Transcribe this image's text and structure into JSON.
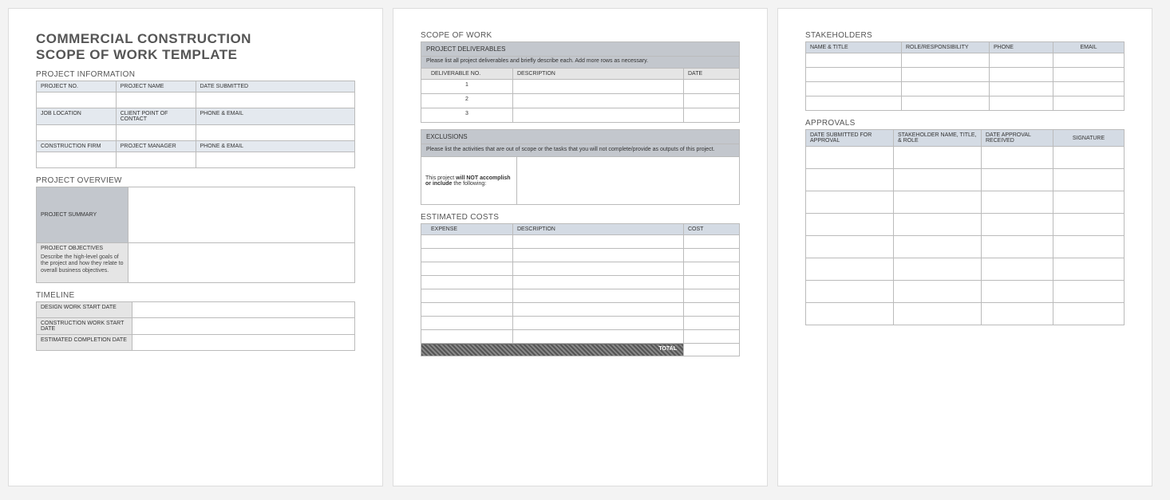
{
  "title_line1": "COMMERCIAL CONSTRUCTION",
  "title_line2": "SCOPE OF WORK TEMPLATE",
  "sections": {
    "project_info": "PROJECT INFORMATION",
    "project_overview": "PROJECT OVERVIEW",
    "timeline": "TIMELINE",
    "scope_of_work": "SCOPE OF WORK",
    "estimated_costs": "ESTIMATED COSTS",
    "stakeholders": "STAKEHOLDERS",
    "approvals": "APPROVALS"
  },
  "project_info": {
    "project_no": "PROJECT NO.",
    "project_name": "PROJECT NAME",
    "date_submitted": "DATE SUBMITTED",
    "job_location": "JOB LOCATION",
    "client_poc": "CLIENT POINT OF CONTACT",
    "phone_email": "PHONE & EMAIL",
    "construction_firm": "CONSTRUCTION FIRM",
    "project_manager": "PROJECT MANAGER"
  },
  "overview": {
    "summary": "PROJECT SUMMARY",
    "objectives": "PROJECT OBJECTIVES",
    "objectives_desc": "Describe the high-level goals of the project and how they relate to overall business objectives."
  },
  "timeline": {
    "design_start": "DESIGN WORK START DATE",
    "construction_start": "CONSTRUCTION WORK START DATE",
    "completion": "ESTIMATED COMPLETION DATE"
  },
  "deliverables": {
    "banner": "PROJECT DELIVERABLES",
    "instruction": "Please list all project deliverables and briefly describe each. Add more rows as necessary.",
    "col_no": "DELIVERABLE NO.",
    "col_desc": "DESCRIPTION",
    "col_date": "DATE",
    "rows": [
      "1",
      "2",
      "3"
    ]
  },
  "exclusions": {
    "banner": "EXCLUSIONS",
    "instruction": "Please list the activities that are out of scope or the tasks that you will not complete/provide as outputs of this project.",
    "label_pre": "This project ",
    "label_bold": "will NOT accomplish or include",
    "label_post": " the following:"
  },
  "costs": {
    "col_expense": "EXPENSE",
    "col_desc": "DESCRIPTION",
    "col_cost": "COST",
    "total": "TOTAL",
    "row_count": 8
  },
  "stakeholders": {
    "col_name": "NAME & TITLE",
    "col_role": "ROLE/RESPONSIBILITY",
    "col_phone": "PHONE",
    "col_email": "EMAIL",
    "row_count": 4
  },
  "approvals": {
    "col_date_sub": "DATE SUBMITTED FOR APPROVAL",
    "col_stake": "STAKEHOLDER NAME, TITLE, & ROLE",
    "col_date_rec": "DATE APPROVAL RECEIVED",
    "col_sign": "SIGNATURE",
    "row_count": 8
  }
}
